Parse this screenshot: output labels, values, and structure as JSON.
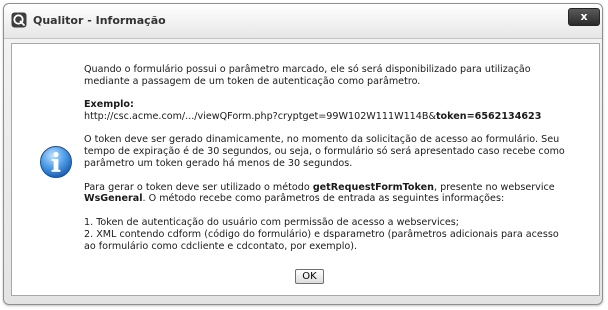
{
  "window": {
    "title": "Qualitor - Informação",
    "close_label": "x"
  },
  "message": {
    "intro_line1": "Quando o formulário possui o parâmetro marcado, ele só será disponibilizado para utilização",
    "intro_line2": "mediante a passagem de um token de autenticação como parâmetro.",
    "example_label": "Exemplo:",
    "example_url": "http://csc.acme.com/.../viewQForm.php?cryptget=99W102W111W114B&",
    "example_token": "token=6562134623",
    "token_line1": "O token deve ser gerado dinamicamente, no momento da solicitação de acesso ao formulário. Seu",
    "token_line2": "tempo de expiração é de 30 segundos, ou seja, o formulário só será apresentado caso recebe como",
    "token_line3": "parâmetro um token gerado há menos de 30 segundos.",
    "method_pre": "Para gerar o token deve ser utilizado o método ",
    "method_name": "getRequestFormToken",
    "method_post": ", presente no webservice",
    "webservice_name": "WsGeneral",
    "method_line2_rest": ". O método recebe como parâmetros de entrada as seguintes informações:",
    "param1": "1. Token de autenticação do usuário com permissão de acesso a webservices;",
    "param2_line1": "2. XML contendo cdform (código do formulário) e dsparametro (parâmetros adicionais para acesso",
    "param2_line2": "ao formulário como cdcliente e cdcontato, por exemplo)."
  },
  "buttons": {
    "ok_label": "OK"
  },
  "icons": {
    "app": "qualitor-app-icon",
    "info": "info-icon",
    "close": "close-icon"
  },
  "colors": {
    "info_blue": "#2a7fd6",
    "close_button": "#3a3a3a"
  }
}
